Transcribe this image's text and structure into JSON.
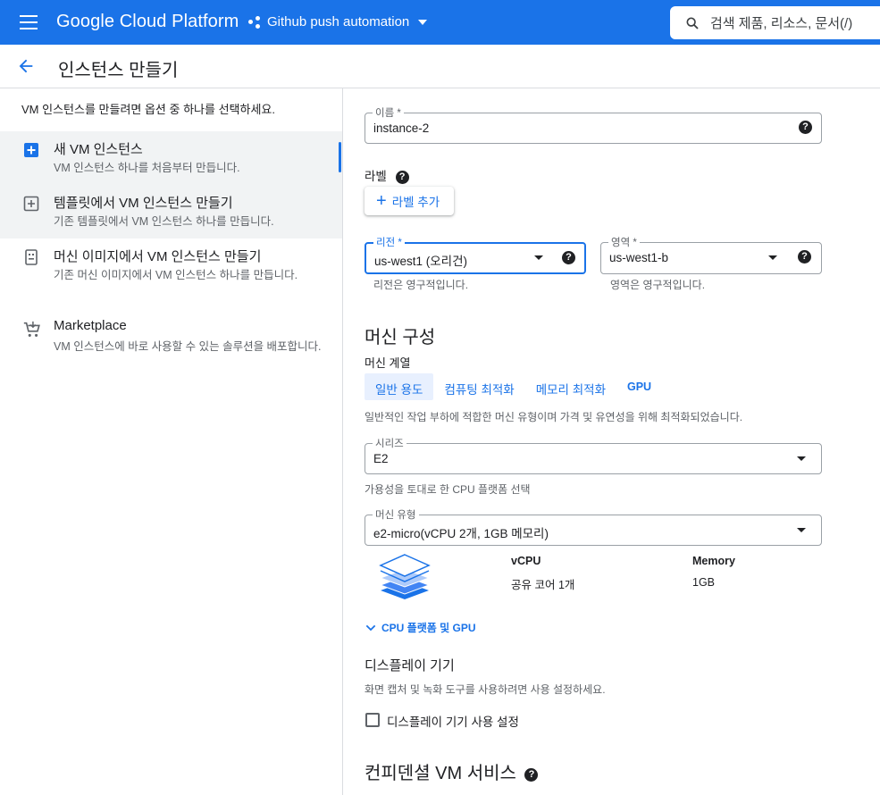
{
  "topbar": {
    "brand": "Google Cloud Platform",
    "project": "Github push automation",
    "search_text": "검색  제품, 리소스, 문서(/)",
    "color": "#1a73e8"
  },
  "page": {
    "title": "인스턴스 만들기"
  },
  "left": {
    "intro": "VM 인스턴스를 만들려면 옵션 중 하나를 선택하세요.",
    "options": [
      {
        "title": "새 VM 인스턴스",
        "desc": "VM 인스턴스 하나를 처음부터 만듭니다.",
        "icon": "add-box-icon"
      },
      {
        "title": "템플릿에서 VM 인스턴스 만들기",
        "desc": "기존 템플릿에서 VM 인스턴스 하나를 만듭니다.",
        "icon": "template-add-icon"
      },
      {
        "title": "머신 이미지에서 VM 인스턴스 만들기",
        "desc": "기존 머신 이미지에서 VM 인스턴스 하나를 만듭니다.",
        "icon": "machine-image-icon"
      },
      {
        "title": "Marketplace",
        "desc": "VM 인스턴스에 바로 사용할 수 있는 솔루션을 배포합니다.",
        "icon": "cart-icon"
      }
    ]
  },
  "form": {
    "name_label": "이름 *",
    "name_value": "instance-2",
    "labels_title": "라벨",
    "add_label": "라벨 추가",
    "region_label": "리전 *",
    "region_value": "us-west1 (오리건)",
    "region_hint": "리전은 영구적입니다.",
    "zone_label": "영역 *",
    "zone_value": "us-west1-b",
    "zone_hint": "영역은 영구적입니다.",
    "machine_config_title": "머신 구성",
    "machine_family_label": "머신 계열",
    "tabs": [
      "일반 용도",
      "컴퓨팅 최적화",
      "메모리 최적화",
      "GPU"
    ],
    "family_desc": "일반적인 작업 부하에 적합한 머신 유형이며 가격 및 유연성을 위해 최적화되었습니다.",
    "series_label": "시리즈",
    "series_value": "E2",
    "series_hint": "가용성을 토대로 한 CPU 플랫폼 선택",
    "machine_type_label": "머신 유형",
    "machine_type_value": "e2-micro(vCPU 2개, 1GB 메모리)",
    "spec_vcpu_label": "vCPU",
    "spec_vcpu_value": "공유 코어 1개",
    "spec_memory_label": "Memory",
    "spec_memory_value": "1GB",
    "cpu_platform_expand": "CPU 플랫폼 및 GPU",
    "display_title": "디스플레이 기기",
    "display_desc": "화면 캡처 및 녹화 도구를 사용하려면 사용 설정하세요.",
    "display_checkbox": "디스플레이 기기 사용 설정",
    "confidential_title": "컨피덴셜 VM 서비스",
    "help_symbol": "?"
  }
}
